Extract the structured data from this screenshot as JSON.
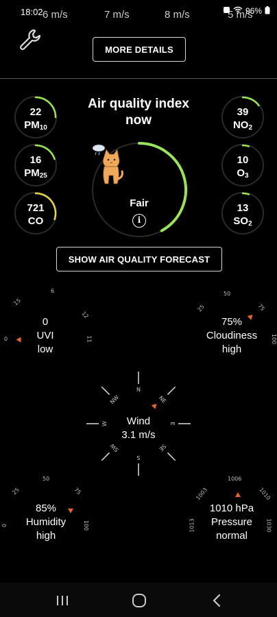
{
  "status": {
    "time": "18:02",
    "wind_readouts": [
      "6 m/s",
      "7 m/s",
      "8 m/s",
      "5 m/s"
    ],
    "battery": "96%"
  },
  "buttons": {
    "more_details": "MORE DETAILS",
    "forecast": "SHOW AIR QUALITY FORECAST"
  },
  "aqi": {
    "title_line1": "Air quality index",
    "title_line2": "now",
    "status": "Fair",
    "info_glyph": "i",
    "level_fraction": 0.42,
    "accent_color": "#9be35a",
    "mascot": "cat-icon"
  },
  "pollutants": {
    "pm10": {
      "value": "22",
      "name": "PM",
      "sub": "10",
      "fraction": 0.25,
      "color": "#9be35a"
    },
    "pm25": {
      "value": "16",
      "name": "PM",
      "sub": "25",
      "fraction": 0.2,
      "color": "#9be35a"
    },
    "co": {
      "value": "721",
      "name": "CO",
      "sub": "",
      "fraction": 0.3,
      "color": "#e6d64a"
    },
    "no2": {
      "value": "39",
      "name": "NO",
      "sub": "2",
      "fraction": 0.15,
      "color": "#9be35a"
    },
    "o3": {
      "value": "10",
      "name": "O",
      "sub": "3",
      "fraction": 0.05,
      "color": "#9be35a"
    },
    "so2": {
      "value": "13",
      "name": "SO",
      "sub": "2",
      "fraction": 0.05,
      "color": "#9be35a"
    }
  },
  "uvi": {
    "value": "0",
    "label": "UVI",
    "level": "low",
    "ticks": [
      "0",
      "6",
      "11",
      "15",
      "12"
    ]
  },
  "cloudiness": {
    "value": "75%",
    "label": "Cloudiness",
    "level": "high",
    "ticks": [
      "25",
      "75",
      "50",
      "100"
    ]
  },
  "wind": {
    "label": "Wind",
    "value": "3.1 m/s",
    "ticks": [
      "N",
      "NE",
      "E",
      "SE",
      "S",
      "SW",
      "W",
      "NW"
    ]
  },
  "humidity": {
    "value": "85%",
    "label": "Humidity",
    "level": "high",
    "ticks": [
      "25",
      "50",
      "75",
      "0",
      "100"
    ]
  },
  "pressure": {
    "value": "1010 hPa",
    "label": "Pressure",
    "level": "normal",
    "ticks": [
      "1006",
      "1003",
      "1010",
      "1013",
      "1030"
    ]
  },
  "icons": {
    "settings": "wrench-icon",
    "nav_recent": "recent-apps-icon",
    "nav_home": "home-icon",
    "nav_back": "back-icon"
  },
  "colors": {
    "accent": "#9be35a",
    "pointer": "#e8642c",
    "co_arc": "#e6d64a"
  }
}
